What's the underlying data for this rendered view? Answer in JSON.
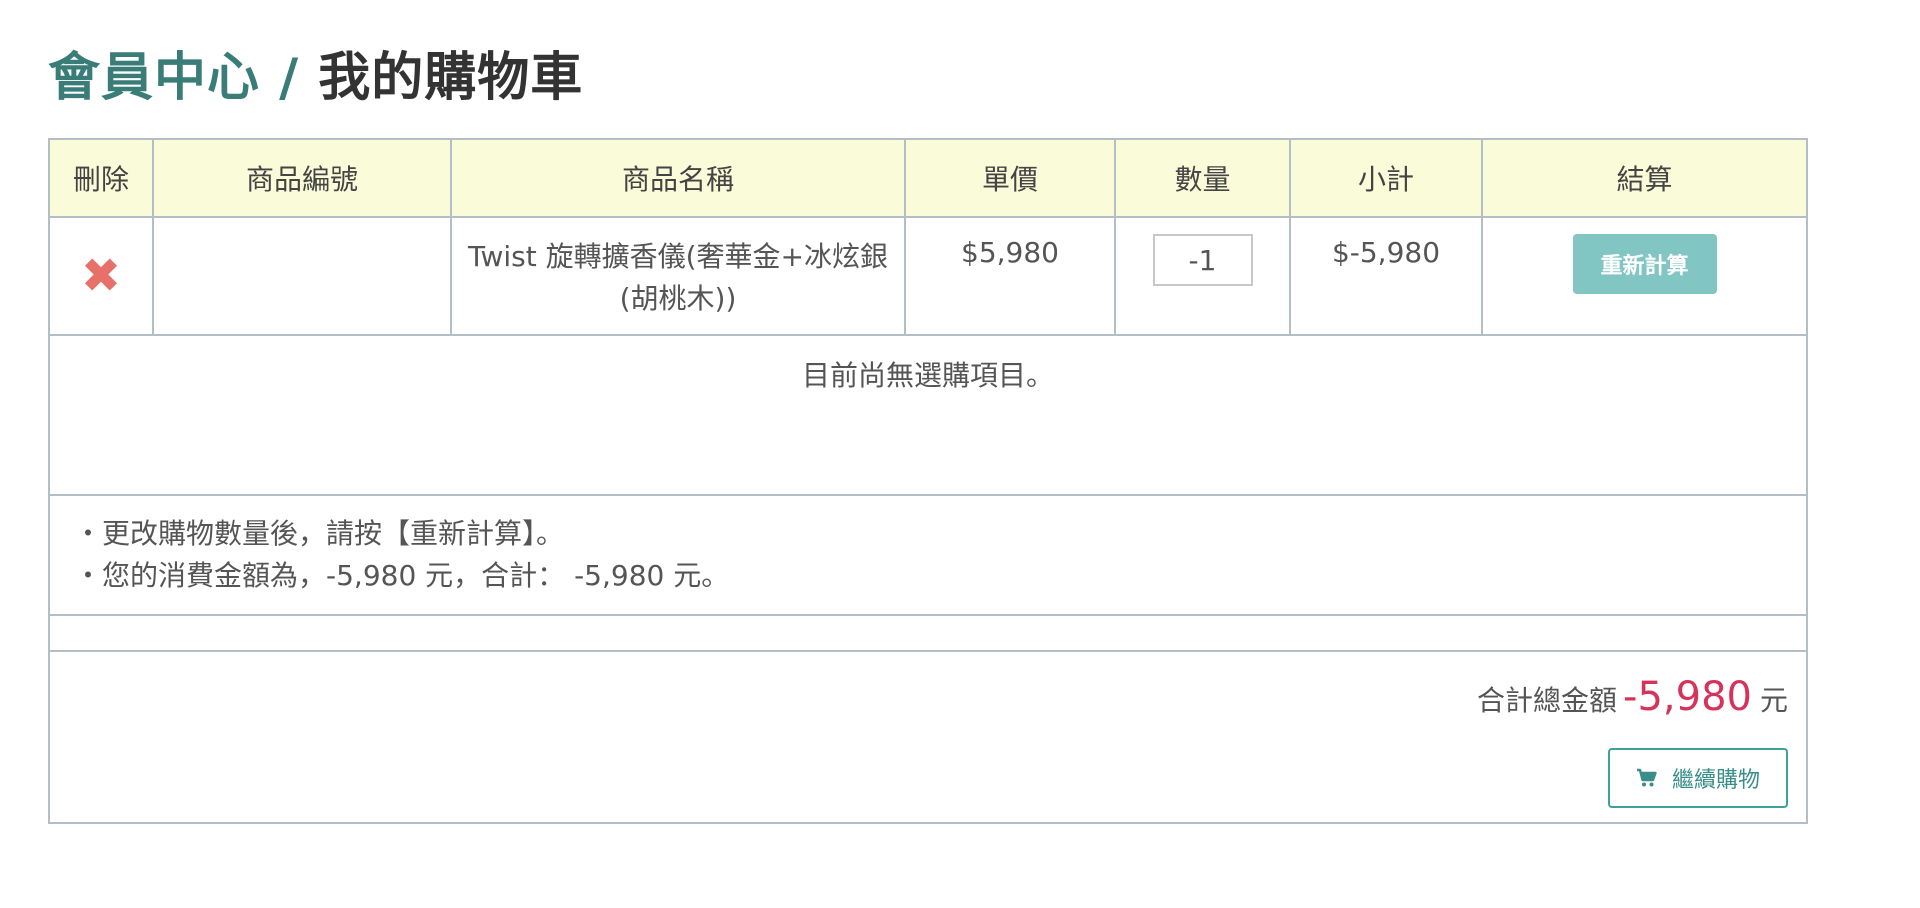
{
  "page": {
    "breadcrumb_parent": "會員中心",
    "separator": " / ",
    "title": "我的購物車"
  },
  "table": {
    "headers": [
      "刪除",
      "商品編號",
      "商品名稱",
      "單價",
      "數量",
      "小計",
      "結算"
    ],
    "items": [
      {
        "remove_icon": "close-icon",
        "sku": "",
        "name": "Twist 旋轉擴香儀(奢華金+冰炫銀(胡桃木))",
        "unit_price": "$5,980",
        "quantity": "-1",
        "subtotal": "$-5,980",
        "recalc_label": "重新計算"
      }
    ]
  },
  "empty_message": "目前尚無選購項目。",
  "notes": [
    "・更改購物數量後，請按【重新計算】。",
    "・您的消費金額為，-5,980 元，合計： -5,980 元。"
  ],
  "total": {
    "label": "合計總金額",
    "value": "-5,980",
    "unit": "元"
  },
  "continue_button": {
    "icon": "shopping-cart-icon",
    "label": "繼續購物"
  },
  "colors": {
    "accent_teal": "#3a7d78",
    "header_bg": "#fafbd8",
    "recalc_bg": "#82c6c4",
    "total_red": "#d6335a",
    "remove_red": "#e8706a"
  }
}
